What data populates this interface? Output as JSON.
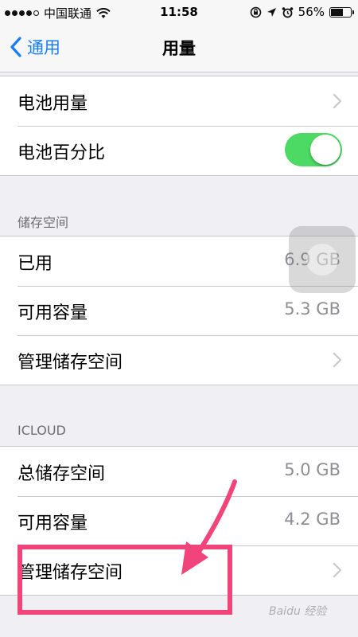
{
  "status_bar": {
    "carrier": "中国联通",
    "time": "11:58",
    "battery_percent": "56%",
    "signal_bars": [
      true,
      true,
      true,
      true,
      false
    ]
  },
  "nav": {
    "back_label": "通用",
    "title": "用量"
  },
  "battery_section": {
    "items": [
      {
        "label": "电池用量"
      },
      {
        "label": "电池百分比",
        "toggle_on": true
      }
    ]
  },
  "storage_section": {
    "header": "储存空间",
    "items": [
      {
        "label": "已用",
        "value": "6.9 GB"
      },
      {
        "label": "可用容量",
        "value": "5.3 GB"
      },
      {
        "label": "管理储存空间"
      }
    ]
  },
  "icloud_section": {
    "header": "ICLOUD",
    "items": [
      {
        "label": "总储存空间",
        "value": "5.0 GB"
      },
      {
        "label": "可用容量",
        "value": "4.2 GB"
      },
      {
        "label": "管理储存空间"
      }
    ]
  },
  "watermark": "Baidu 经验",
  "colors": {
    "accent": "#157efb",
    "toggle_on": "#4cd964",
    "highlight": "#f0447a",
    "background": "#efeff4"
  }
}
